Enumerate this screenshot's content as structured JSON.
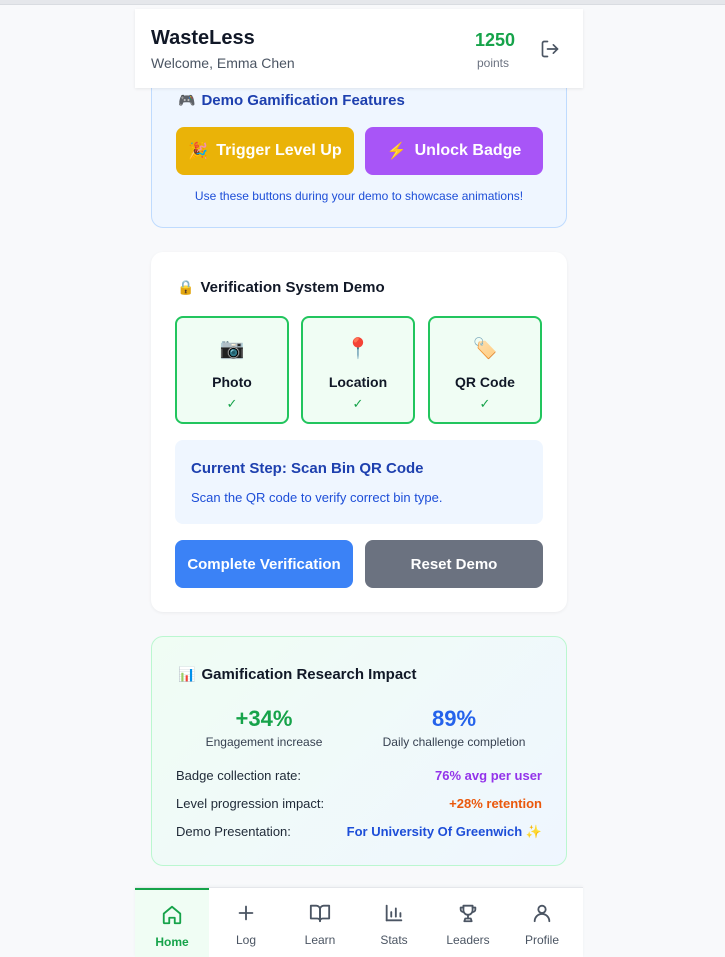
{
  "header": {
    "app_title": "WasteLess",
    "welcome": "Welcome, Emma Chen",
    "points_value": "1250",
    "points_label": "points",
    "logout_icon": "logout-icon"
  },
  "demo_gamification": {
    "emoji": "🎮",
    "title": "Demo Gamification Features",
    "level_up_emoji": "🎉",
    "level_up_label": "Trigger Level Up",
    "badge_emoji": "⚡",
    "badge_label": "Unlock Badge",
    "note": "Use these buttons during your demo to showcase animations!"
  },
  "verification": {
    "emoji": "🔒",
    "title": "Verification System Demo",
    "steps": [
      {
        "icon": "📷",
        "label": "Photo",
        "check": "✓"
      },
      {
        "icon": "📍",
        "label": "Location",
        "check": "✓"
      },
      {
        "icon": "🏷️",
        "label": "QR Code",
        "check": "✓"
      }
    ],
    "current_step_title": "Current Step: Scan Bin QR Code",
    "current_step_desc": "Scan the QR code to verify correct bin type.",
    "complete_label": "Complete Verification",
    "reset_label": "Reset Demo"
  },
  "research": {
    "emoji": "📊",
    "title": "Gamification Research Impact",
    "stat1_value": "+34%",
    "stat1_label": "Engagement increase",
    "stat2_value": "89%",
    "stat2_label": "Daily challenge completion",
    "rows": [
      {
        "label": "Badge collection rate:",
        "value": "76% avg per user",
        "color": "#9333ea"
      },
      {
        "label": "Level progression impact:",
        "value": "+28% retention",
        "color": "#ea580c"
      },
      {
        "label": "Demo Presentation:",
        "value": "For University Of Greenwich ✨",
        "color": "#1d4ed8"
      }
    ]
  },
  "nav": {
    "items": [
      {
        "label": "Home",
        "icon": "home-icon",
        "active": true
      },
      {
        "label": "Log",
        "icon": "plus-icon",
        "active": false
      },
      {
        "label": "Learn",
        "icon": "book-icon",
        "active": false
      },
      {
        "label": "Stats",
        "icon": "bar-chart-icon",
        "active": false
      },
      {
        "label": "Leaders",
        "icon": "trophy-icon",
        "active": false
      },
      {
        "label": "Profile",
        "icon": "user-icon",
        "active": false
      }
    ]
  },
  "colors": {
    "primary_green": "#16a34a",
    "accent_blue": "#3b82f6",
    "yellow": "#eab308",
    "purple": "#a855f7",
    "gray_button": "#6b7280"
  }
}
